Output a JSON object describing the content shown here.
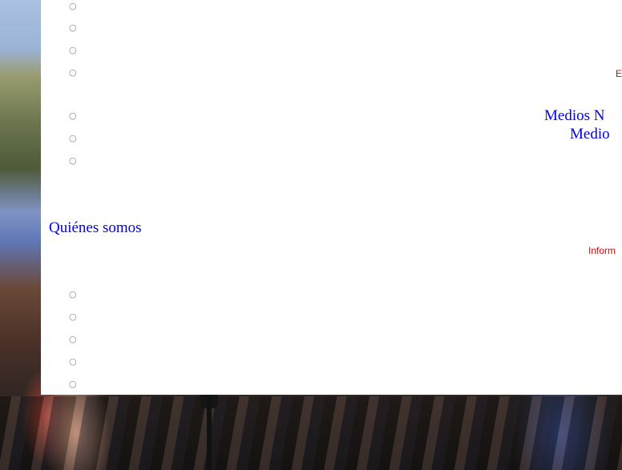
{
  "bullet_glyph": "○",
  "menu_a": {
    "bullets": [
      "○",
      "○",
      "○",
      "○",
      "○",
      "○",
      "○"
    ],
    "links": {
      "medios_n": "Medios N",
      "medio": "Medio"
    },
    "red_label": "E"
  },
  "quienes_somos": "Quiénes somos",
  "menu_b": {
    "red_label": "Inform",
    "bullets": [
      "○",
      "○",
      "○",
      "○",
      "○"
    ]
  }
}
